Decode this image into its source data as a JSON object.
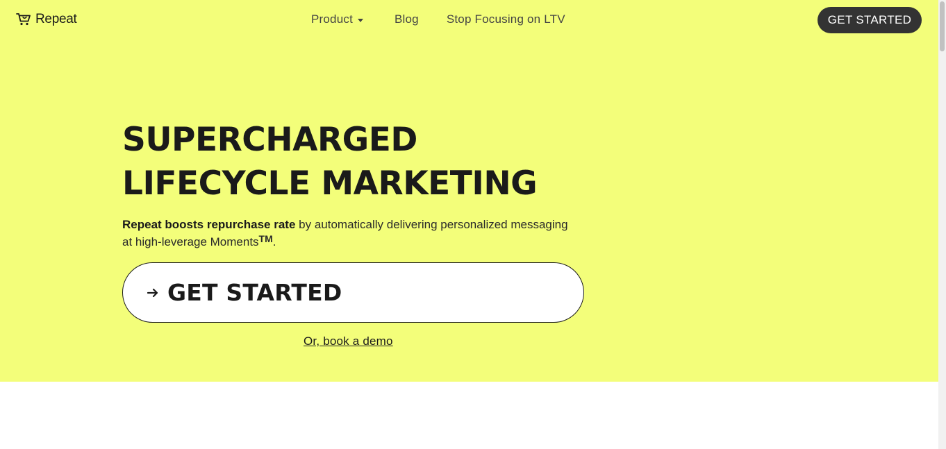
{
  "nav": {
    "logo_text": "Repeat",
    "items": [
      {
        "label": "Product",
        "has_dropdown": true
      },
      {
        "label": "Blog"
      },
      {
        "label": "Stop Focusing on LTV"
      }
    ],
    "cta_label": "GET STARTED"
  },
  "hero": {
    "headline_line1": "SUPERCHARGED",
    "headline_line2": "LIFECYCLE MARKETING",
    "subtext_bold": "Repeat boosts repurchase rate",
    "subtext_rest": " by automatically delivering personalized messaging at high-leverage Moments",
    "subtext_tm": "TM",
    "subtext_end": ".",
    "cta_label": "GET STARTED",
    "demo_link": "Or, book a demo"
  },
  "colors": {
    "hero_background": "#f3fe7a",
    "text": "#1a1a1a",
    "nav_cta_background": "#333333"
  },
  "icons": {
    "logo": "shopping-cart-icon",
    "cta": "arrow-right-icon",
    "dropdown": "caret-down-icon"
  }
}
